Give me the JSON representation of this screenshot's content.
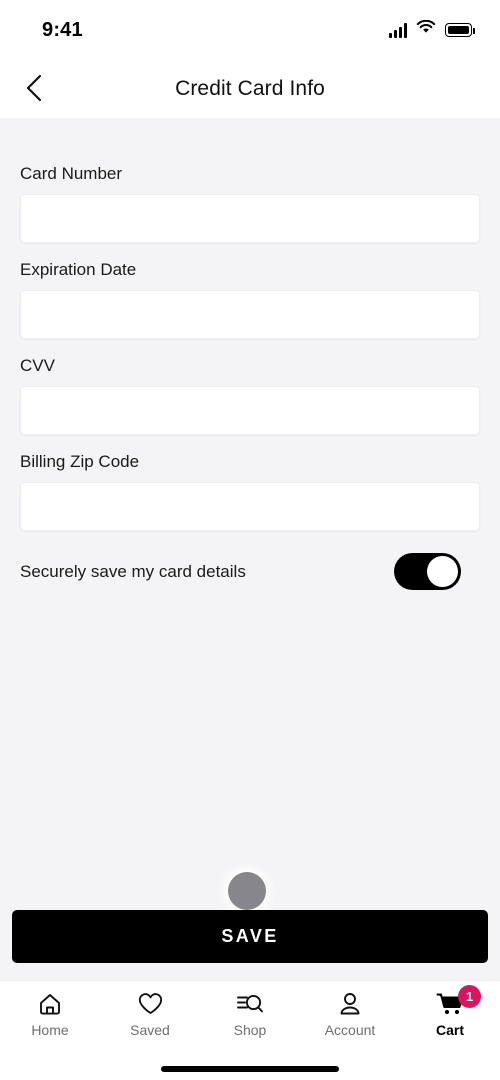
{
  "status_bar": {
    "time": "9:41",
    "signal_icon": "cellular-signal-icon",
    "wifi_icon": "wifi-icon",
    "battery_icon": "battery-full-icon"
  },
  "header": {
    "back_icon": "chevron-left-icon",
    "title": "Credit Card Info"
  },
  "form": {
    "fields": [
      {
        "label": "Card Number",
        "value": "",
        "placeholder": ""
      },
      {
        "label": "Expiration Date",
        "value": "",
        "placeholder": ""
      },
      {
        "label": "CVV",
        "value": "",
        "placeholder": ""
      },
      {
        "label": "Billing Zip Code",
        "value": "",
        "placeholder": ""
      }
    ],
    "toggle": {
      "label": "Securely save my card details",
      "state": "on"
    }
  },
  "overlay": {
    "touch_indicator": "tap-indicator-dot"
  },
  "primary_action": {
    "save_label": "SAVE"
  },
  "tabbar": {
    "items": [
      {
        "label": "Home",
        "icon": "home-icon",
        "active": false
      },
      {
        "label": "Saved",
        "icon": "heart-icon",
        "active": false
      },
      {
        "label": "Shop",
        "icon": "search-list-icon",
        "active": false
      },
      {
        "label": "Account",
        "icon": "person-icon",
        "active": false
      },
      {
        "label": "Cart",
        "icon": "shopping-cart-icon",
        "active": true,
        "badge": "1"
      }
    ]
  },
  "colors": {
    "background": "#f4f4f6",
    "surface": "#ffffff",
    "accent": "#e0115f",
    "primary": "#000000",
    "muted_text": "#6e6e73"
  }
}
